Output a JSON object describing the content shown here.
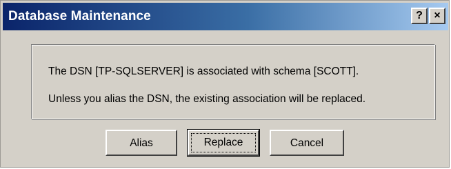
{
  "window": {
    "title": "Database Maintenance",
    "help_label": "?",
    "close_label": "×"
  },
  "message": {
    "line1": "The DSN [TP-SQLSERVER] is associated with schema [SCOTT].",
    "line2": "Unless you alias the DSN, the existing association will be replaced."
  },
  "buttons": {
    "alias": "Alias",
    "replace": "Replace",
    "cancel": "Cancel",
    "default": "replace"
  },
  "colors": {
    "title_start": "#0a246a",
    "title_end": "#a6caf0",
    "face": "#d4d0c8"
  }
}
